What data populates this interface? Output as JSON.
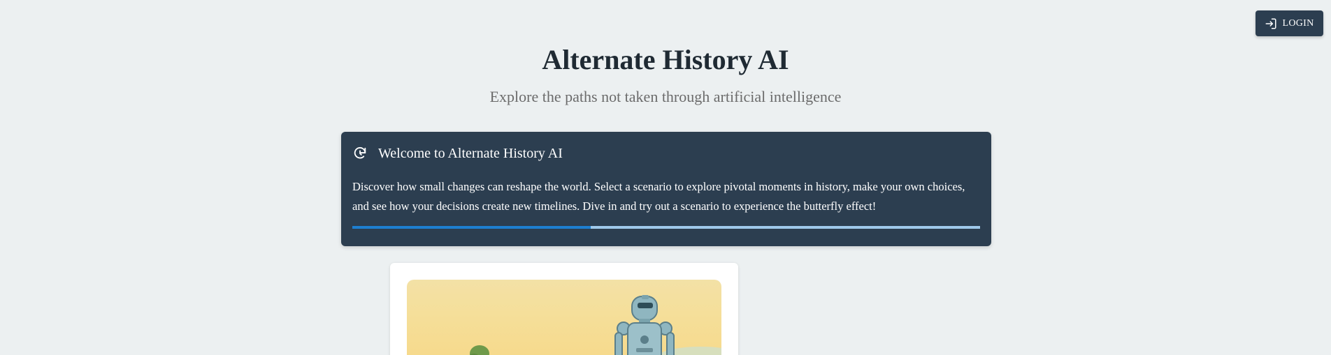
{
  "header": {
    "login_label": "LOGIN",
    "login_icon": "login-icon"
  },
  "hero": {
    "title": "Alternate History AI",
    "subtitle": "Explore the paths not taken through artificial intelligence"
  },
  "welcome": {
    "icon": "refresh-icon",
    "title": "Welcome to Alternate History AI",
    "text": "Discover how small changes can reshape the world. Select a scenario to explore pivotal moments in history, make your own choices, and see how your decisions create new timelines. Dive in and try out a scenario to experience the butterfly effect!",
    "progress": 0.38
  },
  "scenario": {
    "image": "robot-illustration"
  },
  "colors": {
    "background": "#ecf0f1",
    "card_dark": "#2c3e50",
    "progress_fill": "#1e7fd0",
    "progress_track": "#9fc9ea"
  }
}
